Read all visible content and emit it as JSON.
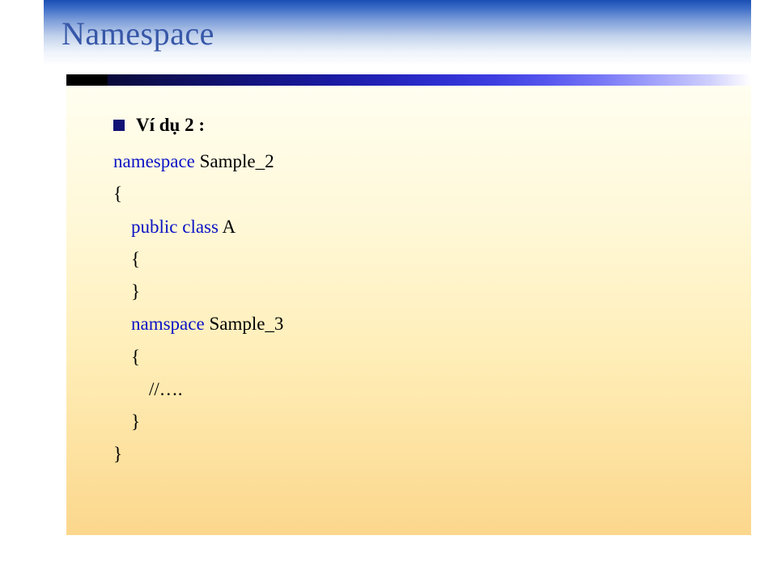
{
  "title": "Namespace",
  "bullet": "Ví dụ 2 :",
  "code": {
    "l1_kw": "namespace",
    "l1_rest": "  Sample_2",
    "l2": "{",
    "l3_kw": "public class ",
    "l3_rest": "A",
    "l4": "{",
    "l5": "}",
    "l6_kw": "namspace ",
    "l6_rest": "Sample_3",
    "l7": "{",
    "l8": "//….",
    "l9": "}",
    "l10": "}"
  }
}
